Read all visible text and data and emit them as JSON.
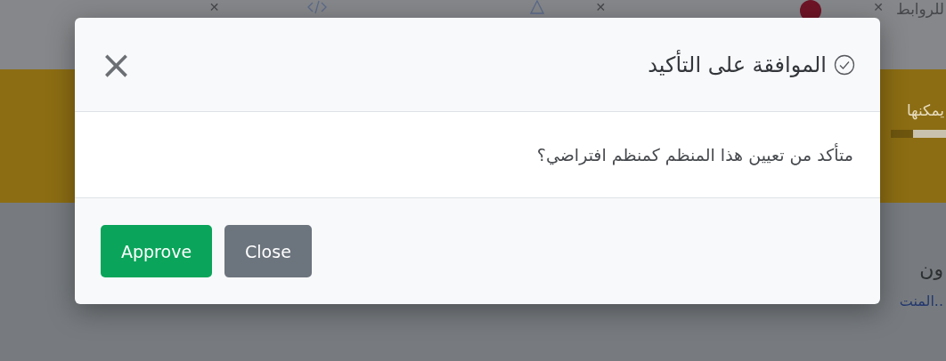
{
  "background": {
    "top_bar": [
      {
        "kind": "text",
        "label": "للروابط"
      },
      {
        "kind": "close",
        "label": "✕"
      },
      {
        "kind": "badge"
      },
      {
        "kind": "close",
        "label": "✕"
      },
      {
        "kind": "warning"
      },
      {
        "kind": "code"
      },
      {
        "kind": "close",
        "label": "✕"
      }
    ],
    "banner": {
      "text": "يمكنها",
      "level": 0.6
    },
    "section": {
      "heading": "ون",
      "link": "المنت.."
    }
  },
  "dialog": {
    "title": "الموافقة على التأكيد",
    "message": "متأكد من تعيين هذا المنظم كمنظم افتراضي؟",
    "close_label": "×",
    "buttons": [
      {
        "label": "Close",
        "kind": "secondary"
      },
      {
        "label": "Approve",
        "kind": "primary"
      }
    ]
  }
}
